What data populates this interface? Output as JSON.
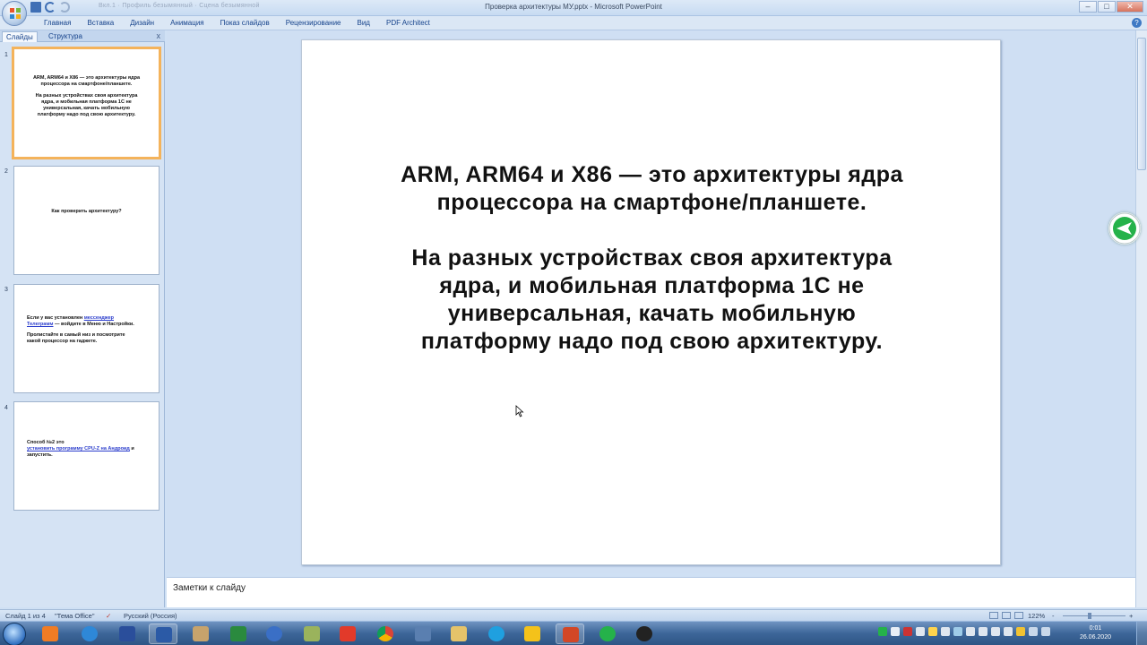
{
  "window": {
    "title": "Проверка архитектуры МУ.pptx - Microsoft PowerPoint",
    "blurred_tabs": "Вкл.1 · Профиль безымянный · Сцена безымянной"
  },
  "ribbon": {
    "tabs": [
      "Главная",
      "Вставка",
      "Дизайн",
      "Анимация",
      "Показ слайдов",
      "Рецензирование",
      "Вид",
      "PDF Architect"
    ]
  },
  "left_panel": {
    "tabs": [
      "Слайды",
      "Структура"
    ],
    "close": "x",
    "thumbnails": [
      {
        "number": "1",
        "selected": true,
        "lines": [
          "ARM, ARM64 и X86 — это архитектуры ядра",
          "процессора на смартфоне/планшете."
        ],
        "lines2": [
          "На разных устройствах своя архитектура",
          "ядра, и мобильная платформа 1С не",
          "универсальная, качать мобильную",
          "платформу надо под свою архитектуру."
        ]
      },
      {
        "number": "2",
        "text": "Как проверить архитектуру?"
      },
      {
        "number": "3",
        "l1_pre": "Если у вас установлен ",
        "l1_link": "мессенджер",
        "l2_link": "Телеграмм",
        "l2_post": " — войдите в Меню и Настройки.",
        "l3": "Пролистайте в самый низ и посмотрите",
        "l4": "какой процессор на гаджете."
      },
      {
        "number": "4",
        "l1": "Способ №2 это",
        "l2_link": "установить программу CPU-Z на Андроид",
        "l2_post": " и",
        "l3": "запустить."
      }
    ]
  },
  "slide": {
    "paragraph1": [
      "ARM, ARM64 и X86 — это архитектуры ядра",
      "процессора на смартфоне/планшете."
    ],
    "paragraph2": [
      "На разных устройствах своя архитектура",
      "ядра, и мобильная платформа 1С не",
      "универсальная,  качать мобильную",
      "платформу надо под свою архитектуру."
    ]
  },
  "notes": {
    "placeholder": "Заметки к слайду"
  },
  "statusbar": {
    "slide_info": "Слайд 1 из 4",
    "theme": "\"Тема Office\"",
    "language": "Русский (Россия)",
    "zoom": "122%",
    "zoom_minus": "-",
    "zoom_plus": "+"
  },
  "taskbar": {
    "apps": [
      "media-player-icon",
      "internet-explorer-icon",
      "save-icon",
      "word-icon",
      "paint-icon",
      "excel-icon",
      "thunderbird-icon",
      "notes-icon",
      "yandex-icon",
      "chrome-icon",
      "computer-icon",
      "explorer-icon",
      "skype-icon",
      "1c-icon",
      "powerpoint-icon",
      "messenger-icon",
      "obs-icon"
    ],
    "time": "0:01",
    "date": "26.06.2020"
  },
  "colors": {
    "selection": "#f4b35b",
    "accent": "#15428b",
    "taskbar": "#3d6699"
  }
}
